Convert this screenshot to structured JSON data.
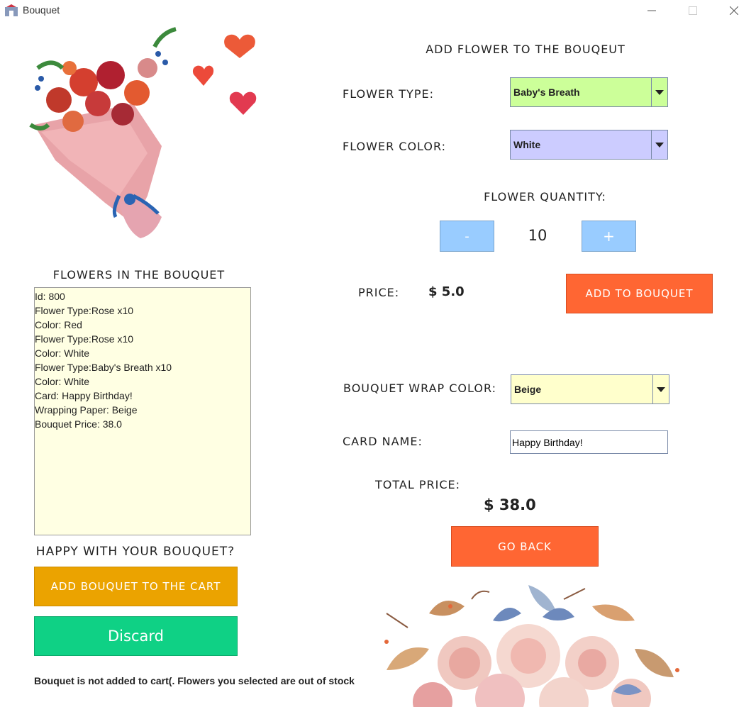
{
  "window": {
    "title": "Bouquet"
  },
  "left": {
    "list_title": "FLOWERS IN THE BOUQUET",
    "list_lines": [
      "Id: 800",
      "Flower Type:Rose x10",
      "Color: Red",
      "Flower Type:Rose x10",
      "Color: White",
      "Flower Type:Baby's Breath x10",
      "Color: White",
      "Card: Happy Birthday!",
      "Wrapping Paper: Beige",
      "Bouquet Price: 38.0"
    ],
    "happy_label": "HAPPY WITH YOUR BOUQUET?",
    "add_cart_label": "ADD BOUQUET TO THE CART",
    "discard_label": "Discard",
    "status_message": "Bouquet is not added to cart(. Flowers you selected are out of stock"
  },
  "right": {
    "section_title": "ADD FLOWER TO THE BOUQEUT",
    "flower_type_label": "FLOWER TYPE:",
    "flower_type_value": "Baby's Breath",
    "flower_color_label": "FLOWER COLOR:",
    "flower_color_value": "White",
    "quantity_label": "FLOWER QUANTITY:",
    "minus_label": "-",
    "quantity_value": "10",
    "plus_label": "+",
    "price_label": "PRICE:",
    "price_value": "$ 5.0",
    "add_to_bouquet_label": "ADD TO BOUQUET",
    "wrap_color_label": "BOUQUET WRAP COLOR:",
    "wrap_color_value": "Beige",
    "card_name_label": "CARD NAME:",
    "card_name_value": "Happy Birthday!",
    "total_price_label": "TOTAL PRICE:",
    "total_price_value": "$ 38.0",
    "go_back_label": "GO BACK"
  },
  "colors": {
    "orange": "#ff6633",
    "amber": "#eba300",
    "green": "#0fd185",
    "blue_btn": "#99ccff",
    "flower_type_bg": "#ccff99",
    "flower_color_bg": "#ccccff",
    "wrap_bg": "#ffffcc",
    "list_bg": "#ffffe3"
  },
  "icons": [
    "bouquet-illustration",
    "heart-icon",
    "flowers-illustration",
    "dropdown-arrow-icon"
  ]
}
